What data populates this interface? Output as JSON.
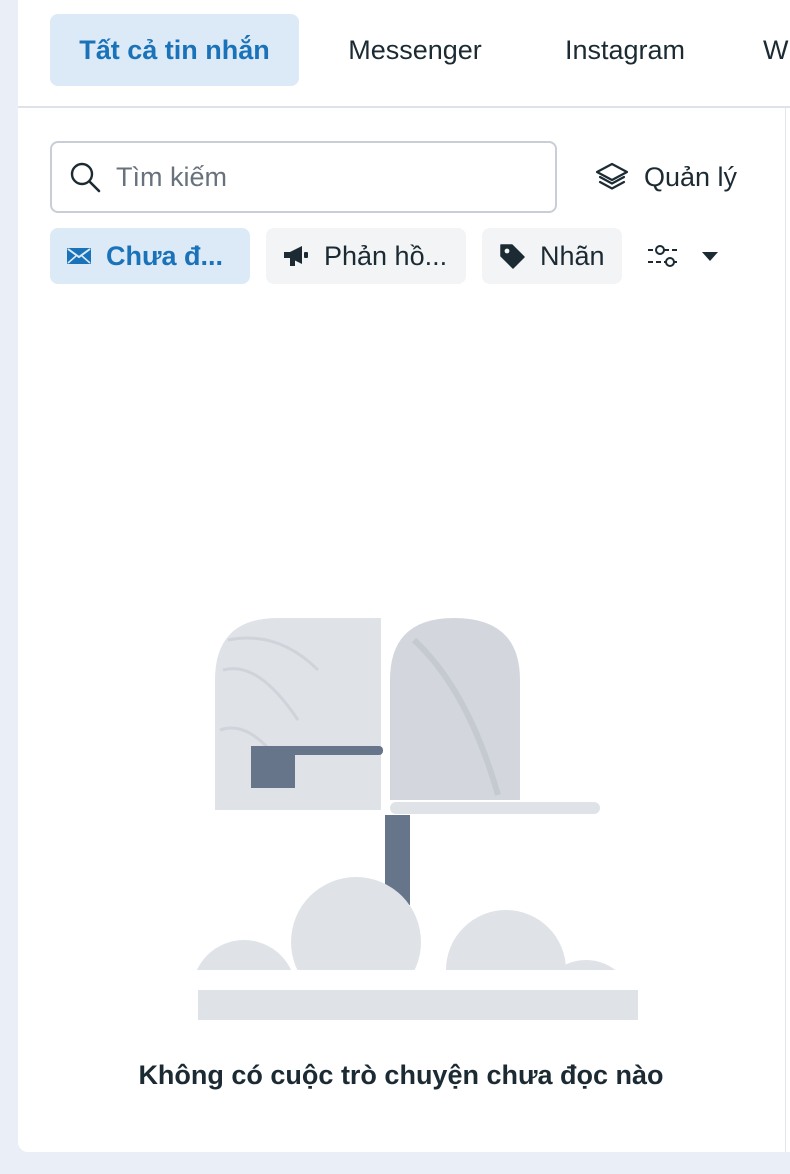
{
  "tabs": [
    {
      "label": "Tất cả tin nhắn",
      "active": true
    },
    {
      "label": "Messenger",
      "active": false
    },
    {
      "label": "Instagram",
      "active": false
    },
    {
      "label": "W",
      "active": false
    }
  ],
  "search": {
    "placeholder": "Tìm kiếm",
    "value": ""
  },
  "manage": {
    "label": "Quản lý",
    "icon": "layers-icon"
  },
  "filters": [
    {
      "label": "Chưa đ...",
      "icon": "envelope-icon",
      "active": true
    },
    {
      "label": "Phản hồ...",
      "icon": "megaphone-icon",
      "active": false
    },
    {
      "label": "Nhãn",
      "icon": "tag-icon",
      "active": false
    }
  ],
  "more_filters": {
    "icons": [
      "sliders-icon",
      "caret-down-icon"
    ]
  },
  "empty_state": {
    "message": "Không có cuộc trò chuyện chưa đọc nào",
    "illustration": "mailbox-illustration"
  },
  "colors": {
    "accent": "#1a73b8",
    "active_bg": "#dceaf7",
    "text": "#1c2b33"
  }
}
